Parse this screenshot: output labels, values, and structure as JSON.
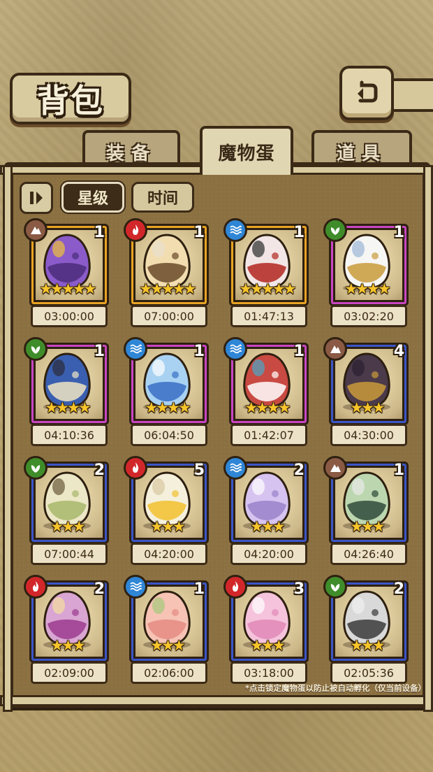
{
  "header": {
    "title": "背包"
  },
  "tabs": [
    {
      "label": "装备",
      "active": false
    },
    {
      "label": "魔物蛋",
      "active": true
    },
    {
      "label": "道具",
      "active": false
    }
  ],
  "sort": {
    "star_label": "星级",
    "time_label": "时间",
    "active": "星级"
  },
  "colors": {
    "rare5": "#e8a323",
    "rare4": "#c846c2",
    "rare3": "#3b56c7",
    "earth": "#8a5a44",
    "fire": "#d2272a",
    "water": "#2f86d6",
    "grass": "#3f8d2a"
  },
  "eggs": [
    {
      "element": "earth",
      "stars": "★★★★★",
      "count": "1",
      "time": "03:00:00",
      "art": "purple-crown-egg"
    },
    {
      "element": "fire",
      "stars": "★★★★★",
      "count": "1",
      "time": "07:00:00",
      "art": "tiger-egg"
    },
    {
      "element": "water",
      "stars": "★★★★★",
      "count": "1",
      "time": "01:47:13",
      "art": "red-spotted-egg"
    },
    {
      "element": "grass",
      "stars": "★★★★",
      "count": "1",
      "time": "03:02:20",
      "art": "golden-ring-egg"
    },
    {
      "element": "grass",
      "stars": "★★★★",
      "count": "1",
      "time": "04:10:36",
      "art": "feather-egg"
    },
    {
      "element": "water",
      "stars": "★★★★",
      "count": "1",
      "time": "06:04:50",
      "art": "blue-ribbon-egg"
    },
    {
      "element": "water",
      "stars": "★★★★",
      "count": "1",
      "time": "01:42:07",
      "art": "rainbow-feather-egg"
    },
    {
      "element": "earth",
      "stars": "★★★",
      "count": "4",
      "time": "04:30:00",
      "art": "bat-wing-egg"
    },
    {
      "element": "grass",
      "stars": "★★★",
      "count": "2",
      "time": "07:00:44",
      "art": "leaf-egg"
    },
    {
      "element": "fire",
      "stars": "★★★",
      "count": "5",
      "time": "04:20:00",
      "art": "sun-egg"
    },
    {
      "element": "water",
      "stars": "★★★",
      "count": "2",
      "time": "04:20:00",
      "art": "lavender-slime-egg"
    },
    {
      "element": "earth",
      "stars": "★★★",
      "count": "1",
      "time": "04:26:40",
      "art": "hooded-egg"
    },
    {
      "element": "fire",
      "stars": "★★★",
      "count": "2",
      "time": "02:09:00",
      "art": "mushroom-egg"
    },
    {
      "element": "water",
      "stars": "★★★",
      "count": "1",
      "time": "02:06:00",
      "art": "peach-egg"
    },
    {
      "element": "fire",
      "stars": "★★★",
      "count": "3",
      "time": "03:18:00",
      "art": "pink-slime-egg"
    },
    {
      "element": "grass",
      "stars": "★★★",
      "count": "2",
      "time": "02:05:36",
      "art": "studded-egg"
    }
  ],
  "footnote": "*点击锁定魔物蛋以防止被自动孵化（仅当前设备）"
}
